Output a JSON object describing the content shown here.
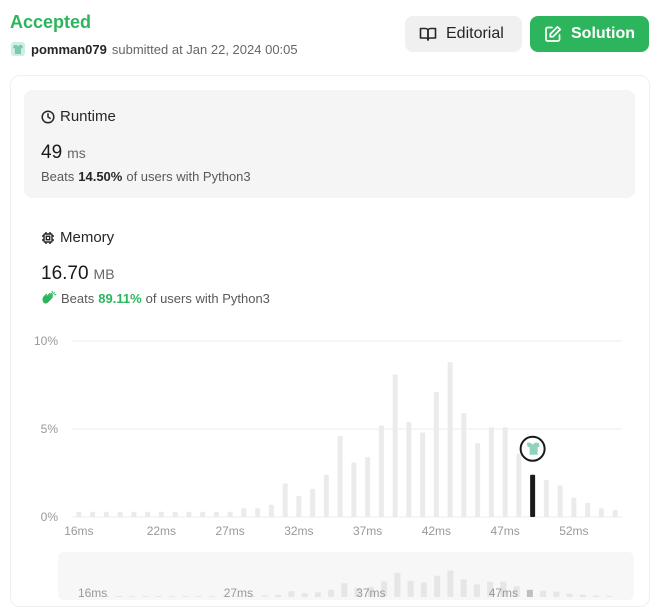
{
  "submission": {
    "status": "Accepted",
    "username": "pomman079",
    "submitted_text": "submitted at Jan 22, 2024 00:05"
  },
  "buttons": {
    "editorial": "Editorial",
    "solution": "Solution"
  },
  "runtime": {
    "title": "Runtime",
    "value": "49",
    "unit": "ms",
    "beats_label": "Beats",
    "beats_pct": "14.50%",
    "beats_suffix": "of users with Python3"
  },
  "memory": {
    "title": "Memory",
    "value": "16.70",
    "unit": "MB",
    "beats_label": "Beats",
    "beats_pct": "89.11%",
    "beats_suffix": "of users with Python3"
  },
  "colors": {
    "accent": "#2db55d",
    "bar": "#ebebeb",
    "selected_bar": "#1a1a1a"
  },
  "chart_data": {
    "type": "bar",
    "ylim": [
      0,
      10
    ],
    "y_ticks": [
      "0%",
      "5%",
      "10%"
    ],
    "x_min_ms": 15.5,
    "x_max_ms": 55.5,
    "x_ticks": [
      {
        "label": "16ms",
        "ms": 16
      },
      {
        "label": "22ms",
        "ms": 22
      },
      {
        "label": "27ms",
        "ms": 27
      },
      {
        "label": "32ms",
        "ms": 32
      },
      {
        "label": "37ms",
        "ms": 37
      },
      {
        "label": "42ms",
        "ms": 42
      },
      {
        "label": "47ms",
        "ms": 47
      },
      {
        "label": "52ms",
        "ms": 52
      }
    ],
    "bars": [
      {
        "ms": 16,
        "value": 0.3
      },
      {
        "ms": 17,
        "value": 0.3
      },
      {
        "ms": 18,
        "value": 0.3
      },
      {
        "ms": 19,
        "value": 0.3
      },
      {
        "ms": 20,
        "value": 0.3
      },
      {
        "ms": 21,
        "value": 0.3
      },
      {
        "ms": 22,
        "value": 0.3
      },
      {
        "ms": 23,
        "value": 0.3
      },
      {
        "ms": 24,
        "value": 0.3
      },
      {
        "ms": 25,
        "value": 0.3
      },
      {
        "ms": 26,
        "value": 0.3
      },
      {
        "ms": 27,
        "value": 0.3
      },
      {
        "ms": 28,
        "value": 0.5
      },
      {
        "ms": 29,
        "value": 0.5
      },
      {
        "ms": 30,
        "value": 0.7
      },
      {
        "ms": 31,
        "value": 1.9
      },
      {
        "ms": 32,
        "value": 1.2
      },
      {
        "ms": 33,
        "value": 1.6
      },
      {
        "ms": 34,
        "value": 2.4
      },
      {
        "ms": 35,
        "value": 4.6
      },
      {
        "ms": 36,
        "value": 3.1
      },
      {
        "ms": 37,
        "value": 3.4
      },
      {
        "ms": 38,
        "value": 5.2
      },
      {
        "ms": 39,
        "value": 8.1
      },
      {
        "ms": 40,
        "value": 5.4
      },
      {
        "ms": 41,
        "value": 4.8
      },
      {
        "ms": 42,
        "value": 7.1
      },
      {
        "ms": 43,
        "value": 8.8
      },
      {
        "ms": 44,
        "value": 5.9
      },
      {
        "ms": 45,
        "value": 4.2
      },
      {
        "ms": 46,
        "value": 5.1
      },
      {
        "ms": 47,
        "value": 5.1
      },
      {
        "ms": 48,
        "value": 3.6
      },
      {
        "ms": 49,
        "value": 2.4
      },
      {
        "ms": 50,
        "value": 2.1
      },
      {
        "ms": 51,
        "value": 1.8
      },
      {
        "ms": 52,
        "value": 1.1
      },
      {
        "ms": 53,
        "value": 0.8
      },
      {
        "ms": 54,
        "value": 0.5
      },
      {
        "ms": 55,
        "value": 0.4
      }
    ],
    "selected_ms": 49,
    "overview_x_ticks": [
      {
        "label": "16ms",
        "ms": 16
      },
      {
        "label": "27ms",
        "ms": 27
      },
      {
        "label": "37ms",
        "ms": 37
      },
      {
        "label": "47ms",
        "ms": 47
      }
    ]
  }
}
